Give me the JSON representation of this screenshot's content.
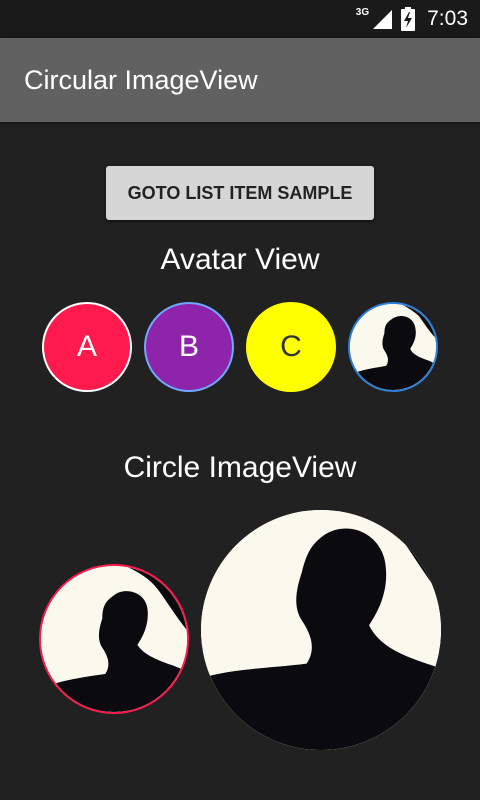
{
  "status_bar": {
    "network": "3G",
    "time": "7:03",
    "icons": [
      "signal-icon",
      "battery-charging-icon"
    ]
  },
  "app_bar": {
    "title": "Circular ImageView"
  },
  "main": {
    "goto_button_label": "GOTO LIST ITEM SAMPLE",
    "avatar_section_title": "Avatar View",
    "avatars": [
      {
        "letter": "A",
        "color": "#ff1a4d",
        "border": "#ffffff"
      },
      {
        "letter": "B",
        "color": "#8e24aa",
        "border": "#6fa7ff"
      },
      {
        "letter": "C",
        "color": "#ffff00",
        "border": "#ffff00"
      }
    ],
    "photo_avatar_border": "#2f7fd9",
    "circle_section_title": "Circle ImageView",
    "circle_small_border": "#ff1a4d"
  },
  "colors": {
    "background": "#212121",
    "app_bar": "#616161",
    "button": "#d6d6d6"
  }
}
